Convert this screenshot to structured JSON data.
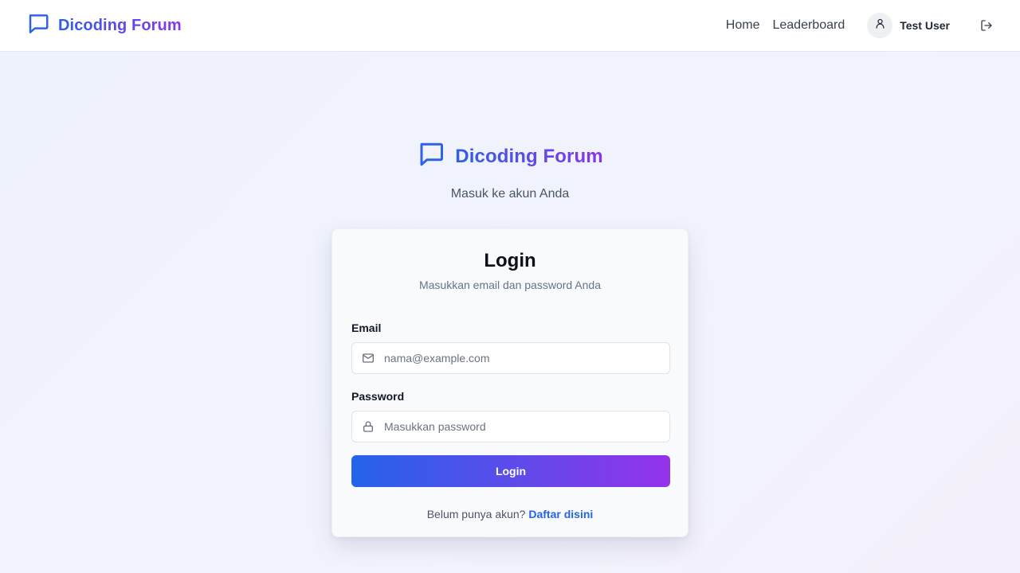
{
  "header": {
    "brand": "Dicoding Forum",
    "nav": {
      "home": "Home",
      "leaderboard": "Leaderboard"
    },
    "user": {
      "name": "Test User"
    },
    "icons": {
      "logo": "message-square-icon",
      "avatar": "user-icon",
      "logout": "log-out-icon"
    }
  },
  "hero": {
    "brand": "Dicoding Forum",
    "subtitle": "Masuk ke akun Anda"
  },
  "login_card": {
    "title": "Login",
    "description": "Masukkan email dan password Anda",
    "email": {
      "label": "Email",
      "placeholder": "nama@example.com",
      "value": "",
      "icon": "mail-icon"
    },
    "password": {
      "label": "Password",
      "placeholder": "Masukkan password",
      "value": "",
      "icon": "lock-icon"
    },
    "submit_label": "Login",
    "signup_prompt": "Belum punya akun?",
    "signup_link": "Daftar disini"
  },
  "colors": {
    "brand_gradient_start": "#2563eb",
    "brand_gradient_end": "#9333ea",
    "link": "#2563eb"
  }
}
